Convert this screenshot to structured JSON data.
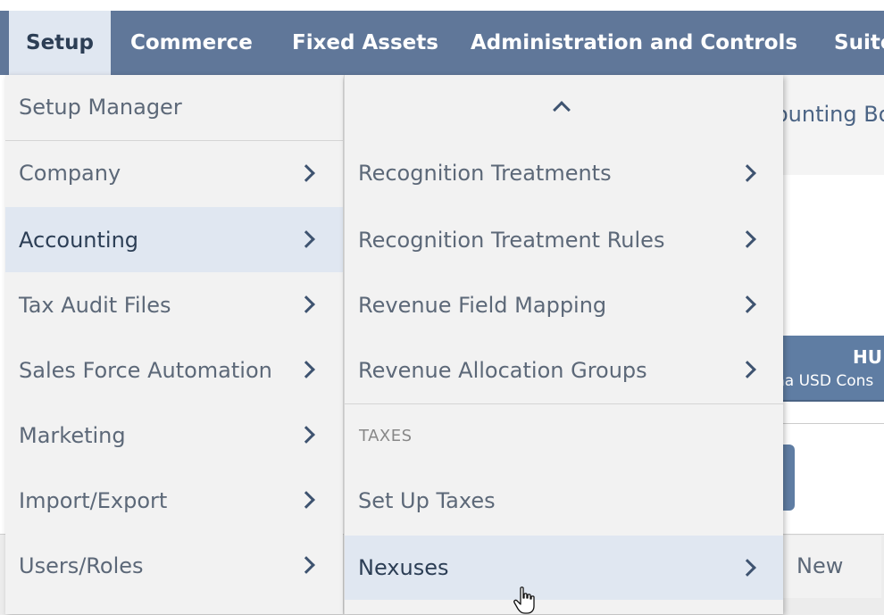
{
  "nav": {
    "tabs": [
      {
        "label": "Setup"
      },
      {
        "label": "Commerce"
      },
      {
        "label": "Fixed Assets"
      },
      {
        "label": "Administration and Controls"
      },
      {
        "label": "Suite"
      }
    ]
  },
  "background": {
    "accounting_books_partial": "ounting Bo",
    "column_header_title": "HU",
    "column_header_sub": "na USD Cons",
    "new_button": "New"
  },
  "setup_menu": {
    "items": [
      {
        "label": "Setup Manager"
      },
      {
        "label": "Company"
      },
      {
        "label": "Accounting"
      },
      {
        "label": "Tax Audit Files"
      },
      {
        "label": "Sales Force Automation"
      },
      {
        "label": "Marketing"
      },
      {
        "label": "Import/Export"
      },
      {
        "label": "Users/Roles"
      }
    ]
  },
  "accounting_submenu": {
    "items": [
      {
        "label": "Recognition Treatments"
      },
      {
        "label": "Recognition Treatment Rules"
      },
      {
        "label": "Revenue Field Mapping"
      },
      {
        "label": "Revenue Allocation Groups"
      }
    ],
    "taxes_section": "TAXES",
    "tax_items": [
      {
        "label": "Set Up Taxes"
      },
      {
        "label": "Nexuses"
      }
    ]
  },
  "colors": {
    "nav_bg": "#607799",
    "menu_bg": "#f2f2f2",
    "highlight_bg": "#e0e7f1",
    "menu_text": "#5c6878"
  }
}
